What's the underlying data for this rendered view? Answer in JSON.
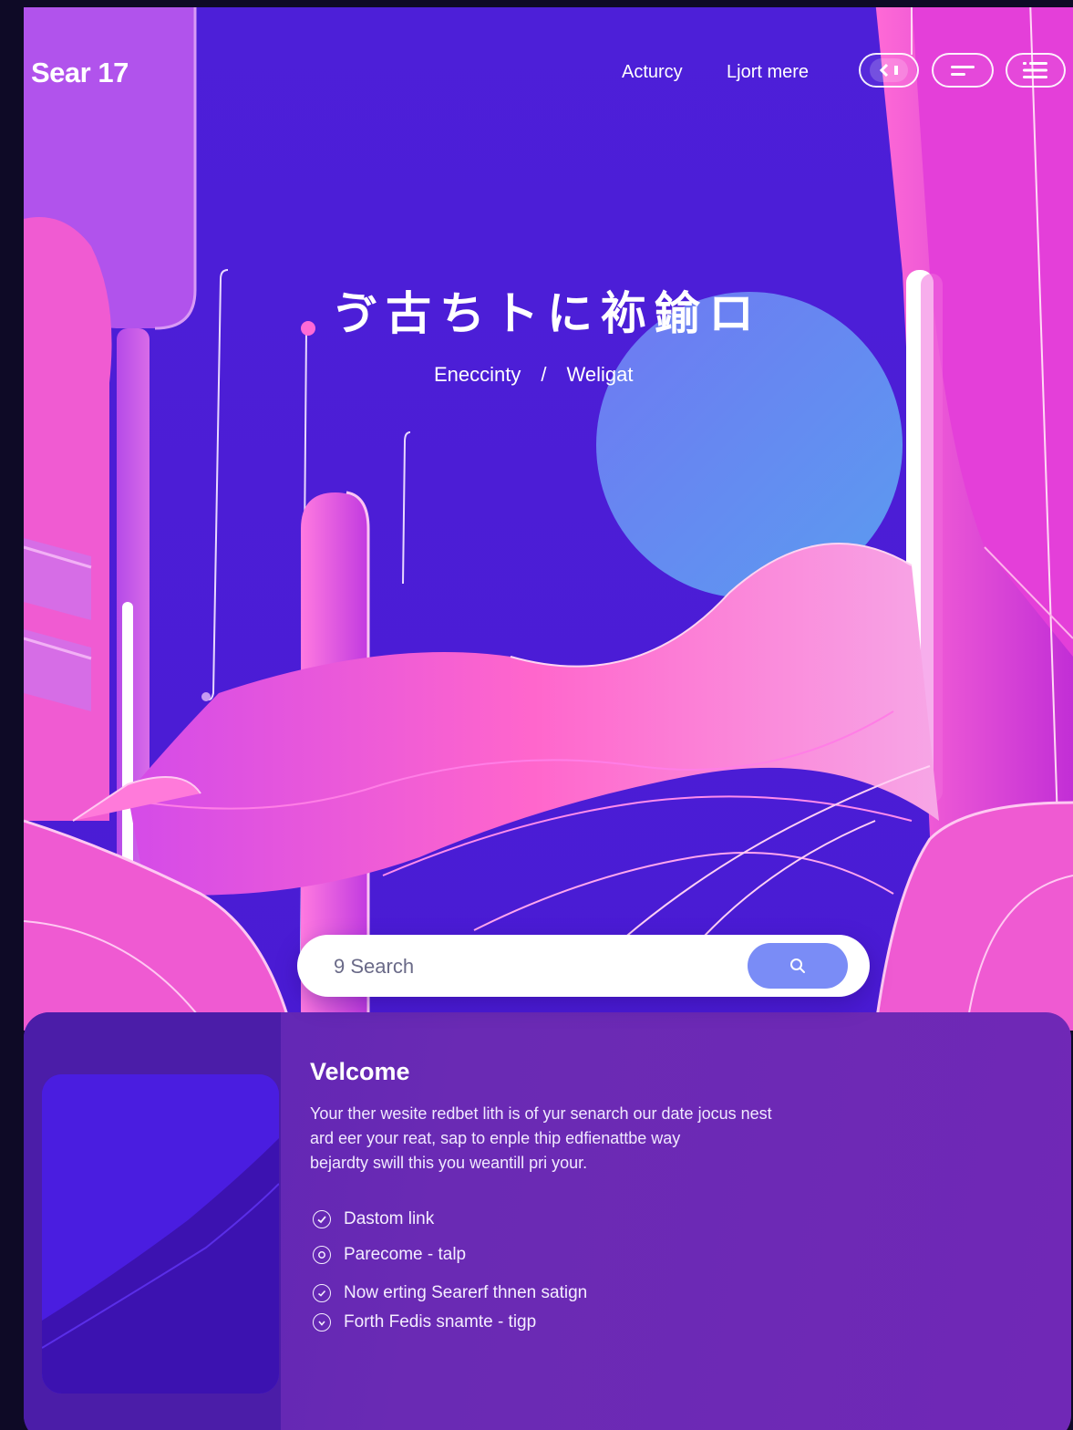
{
  "header": {
    "brand": "Sear 17",
    "nav": [
      "Acturcy",
      "Ljort mere"
    ],
    "controls": [
      {
        "name": "back-toggle",
        "icon": "chevron-left-icon",
        "text": "< ▮"
      },
      {
        "name": "menu-button",
        "icon": "menu-lines-icon"
      },
      {
        "name": "list-button",
        "icon": "list-icon"
      }
    ]
  },
  "hero": {
    "title": "ゔ古ちトに袮鍮ロ",
    "breadcrumb": {
      "first": "Eneccinty",
      "separator": "/",
      "second": "Weligat"
    }
  },
  "search": {
    "placeholder": "9 Search",
    "button_icon": "search-icon"
  },
  "welcome": {
    "title": "Velcome",
    "body_lines": [
      "Your ther wesite redbet lith is of yur senarch our date jocus nest",
      "ard eer your reat, sap to enple thip edfienattbe way",
      "bejardty swill this you weantill pri your."
    ],
    "features": [
      "Dastom link",
      "Parecome - talp",
      "Now erting Searerf thnen satign",
      "Forth Fedis snamte - tigp"
    ]
  },
  "colors": {
    "hero_indigo": "#4b1ddb",
    "magenta": "#e63ad8",
    "pink": "#ff69c8",
    "violet": "#a23be8",
    "sky_circle": "#6a8af0",
    "panel": "#6a2ab4",
    "search_button": "#7a8cf6"
  }
}
